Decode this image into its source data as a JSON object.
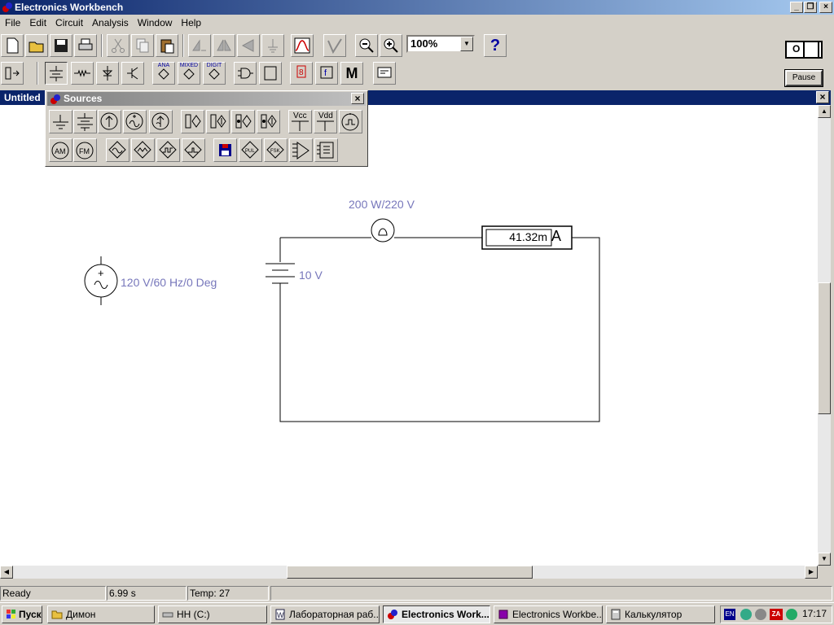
{
  "app": {
    "title": "Electronics Workbench"
  },
  "menu": [
    "File",
    "Edit",
    "Circuit",
    "Analysis",
    "Window",
    "Help"
  ],
  "toolbar": {
    "zoom": "100%",
    "help": "?",
    "pause": "Pause",
    "power": "O"
  },
  "component_bar": {
    "ana": "ANA",
    "mixed": "MIXED",
    "digit": "DIGIT",
    "m": "M"
  },
  "document": {
    "title": "Untitled"
  },
  "sources_palette": {
    "title": "Sources",
    "vcc": "Vcc",
    "vdd": "Vdd",
    "am": "AM",
    "fm": "FM"
  },
  "circuit": {
    "lamp_label": "200 W/220 V",
    "battery_label": "10 V",
    "ac_source_label": "120 V/60 Hz/0 Deg",
    "ammeter_value": "41.32m",
    "ammeter_unit": "A"
  },
  "status": {
    "state": "Ready",
    "time": "6.99 s",
    "temp": "Temp:  27"
  },
  "taskbar": {
    "start": "Пуск",
    "tasks": [
      "Димон",
      "HH (C:)",
      "Лабораторная раб...",
      "Electronics Work...",
      "Electronics Workbe...",
      "Калькулятор"
    ],
    "lang": "EN",
    "clock": "17:17"
  },
  "colors": {
    "title_active": "#0a246a",
    "label": "#7777bb",
    "face": "#d4d0c8"
  }
}
